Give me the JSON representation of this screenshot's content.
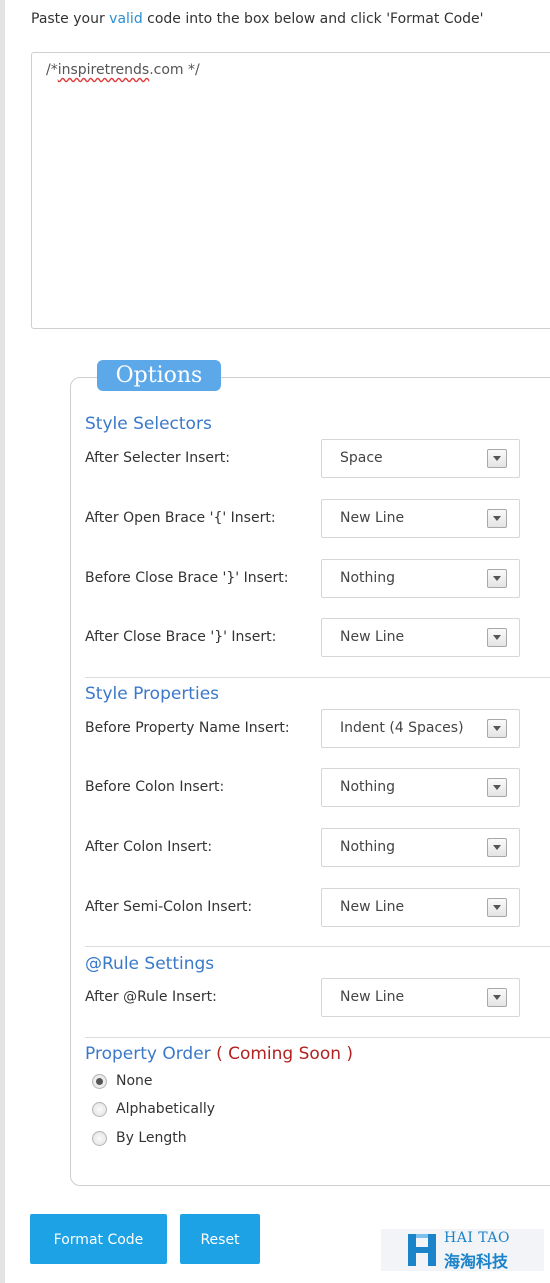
{
  "intro": {
    "before": "Paste your ",
    "highlight": "valid",
    "after": " code into the box below and click 'Format Code'"
  },
  "code": {
    "prefix": "/*",
    "misspelled": "inspiretrends",
    "suffix": ".com */"
  },
  "options": {
    "legend": "Options",
    "sections": {
      "style_selectors": "Style Selectors",
      "style_properties": "Style Properties",
      "rule_settings": "@Rule Settings",
      "property_order": "Property Order",
      "coming_soon": "( Coming Soon )"
    },
    "fields": [
      {
        "label": "After Selecter Insert:",
        "value": "Space"
      },
      {
        "label": "After Open Brace '{' Insert:",
        "value": "New Line"
      },
      {
        "label": "Before Close Brace '}' Insert:",
        "value": "Nothing"
      },
      {
        "label": "After Close Brace '}' Insert:",
        "value": "New Line"
      },
      {
        "label": "Before Property Name Insert:",
        "value": "Indent (4 Spaces)"
      },
      {
        "label": "Before Colon Insert:",
        "value": "Nothing"
      },
      {
        "label": "After Colon Insert:",
        "value": "Nothing"
      },
      {
        "label": "After Semi-Colon Insert:",
        "value": "New Line"
      },
      {
        "label": "After @Rule Insert:",
        "value": "New Line"
      }
    ],
    "property_order": [
      {
        "label": "None",
        "checked": true
      },
      {
        "label": "Alphabetically",
        "checked": false
      },
      {
        "label": "By Length",
        "checked": false
      }
    ]
  },
  "buttons": {
    "format": "Format Code",
    "reset": "Reset"
  },
  "watermark": {
    "top": "HAI TAO",
    "bottom": "海淘科技"
  },
  "colors": {
    "accent_button": "#1ea2e6",
    "legend_bg": "#5da8e8",
    "section_title": "#3a78c9",
    "coming_soon": "#b22222",
    "link": "#2a8fd0"
  }
}
